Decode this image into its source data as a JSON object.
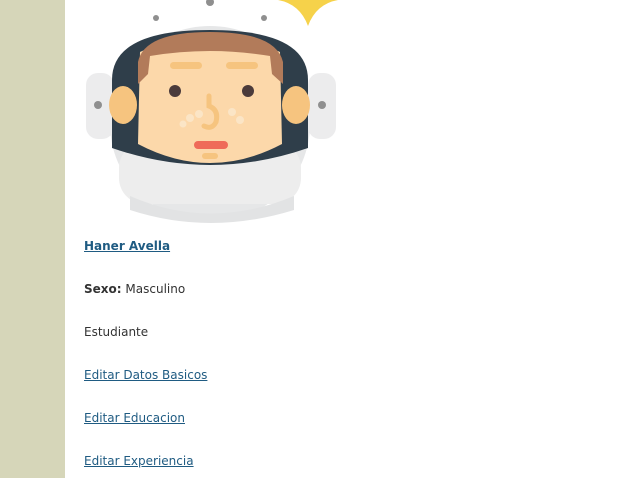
{
  "sidebar": {
    "color": "#d6d6b9"
  },
  "profile": {
    "avatar_icon": "astronaut-avatar-icon",
    "name": "Haner Avella",
    "sex_label": "Sexo:",
    "sex_value": "Masculino",
    "role": "Estudiante"
  },
  "actions": {
    "edit_basic": "Editar Datos Basicos",
    "edit_education": "Editar Educacion",
    "edit_experience": "Editar Experiencia"
  },
  "colors": {
    "link": "#1f5b82",
    "text": "#333333",
    "helmet": "#e6e7e8",
    "visor": "#2f3e4a",
    "skin": "#fcd8aa",
    "hair": "#b27b5a",
    "star": "#f6d24a"
  }
}
